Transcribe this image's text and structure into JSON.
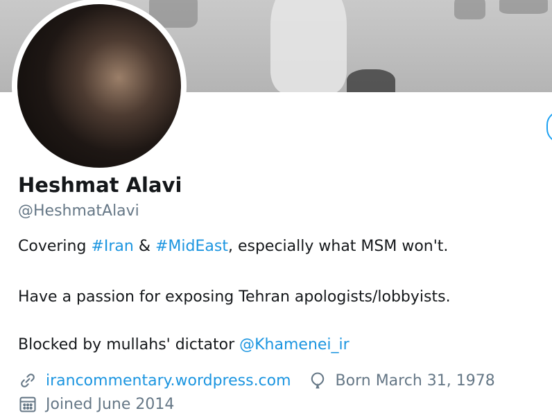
{
  "profile": {
    "name": "Heshmat Alavi",
    "handle": "@HeshmatAlavi"
  },
  "bio": {
    "line1_prefix": "Covering ",
    "hashtag_iran": "#Iran",
    "line1_amp": " & ",
    "hashtag_mideast": "#MidEast",
    "line1_suffix": ", especially what MSM won't.",
    "line2": "Have a passion for exposing Tehran apologists/lobbyists.",
    "line3_prefix": "Blocked by mullahs' dictator ",
    "mention": "@Khamenei_ir"
  },
  "meta": {
    "website": "irancommentary.wordpress.com",
    "birthday": "Born March 31, 1978",
    "joined": "Joined June 2014"
  },
  "icons": {
    "link": "link-icon",
    "birthday": "balloon-icon",
    "joined": "calendar-icon"
  },
  "colors": {
    "link": "#1b95e0",
    "secondary_text": "#657786",
    "primary_text": "#14171a",
    "accent": "#1da1f2"
  }
}
